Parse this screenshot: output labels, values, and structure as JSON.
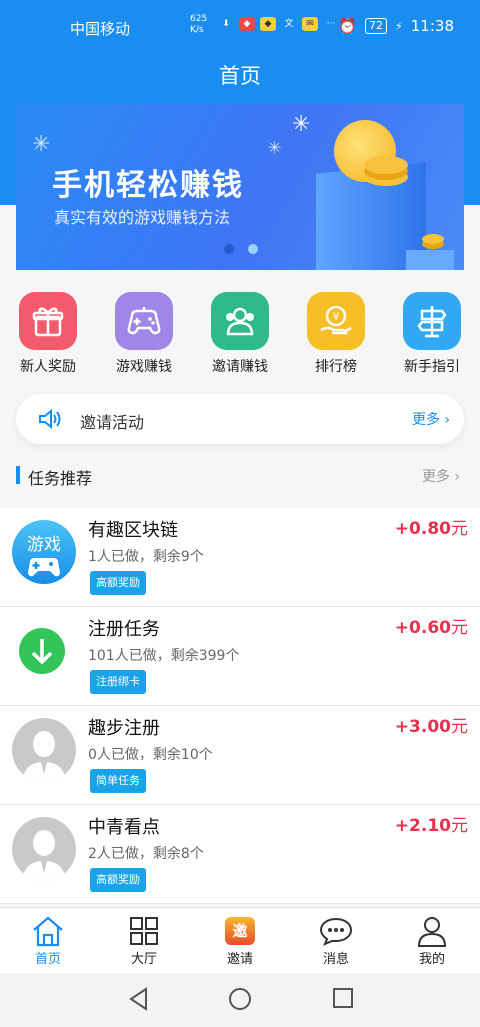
{
  "status": {
    "carrier": "中国移动",
    "net_speed_value": "625",
    "net_speed_unit": "K/s",
    "battery": "72",
    "time": "11:38"
  },
  "header": {
    "title": "首页"
  },
  "banner": {
    "headline": "手机轻松赚钱",
    "subline": "真实有效的游戏赚钱方法",
    "active_dot": 1,
    "dot_count": 2
  },
  "grid": [
    {
      "label": "新人奖励",
      "icon": "gift-icon",
      "color": "#f25b6e"
    },
    {
      "label": "游戏赚钱",
      "icon": "gamepad-icon",
      "color": "#9f86e8"
    },
    {
      "label": "邀请赚钱",
      "icon": "users-icon",
      "color": "#2fba8a"
    },
    {
      "label": "排行榜",
      "icon": "coin-hand-icon",
      "color": "#f8be26"
    },
    {
      "label": "新手指引",
      "icon": "signpost-icon",
      "color": "#30a8f2"
    }
  ],
  "notice": {
    "text": "邀请活动",
    "more": "更多"
  },
  "section": {
    "title": "任务推荐",
    "more": "更多"
  },
  "tasks": [
    {
      "name": "有趣区块链",
      "meta": "1人已做，剩余9个",
      "tag": "高额奖励",
      "price": "+0.80",
      "unit": "元",
      "avatar": "game-avatar",
      "avatar_text": "游戏"
    },
    {
      "name": "注册任务",
      "meta": "101人已做，剩余399个",
      "tag": "注册绑卡",
      "price": "+0.60",
      "unit": "元",
      "avatar": "download-avatar"
    },
    {
      "name": "趣步注册",
      "meta": "0人已做，剩余10个",
      "tag": "简单任务",
      "price": "+3.00",
      "unit": "元",
      "avatar": "person-avatar"
    },
    {
      "name": "中青看点",
      "meta": "2人已做，剩余8个",
      "tag": "高额奖励",
      "price": "+2.10",
      "unit": "元",
      "avatar": "person-avatar"
    }
  ],
  "tabs": [
    {
      "label": "首页",
      "icon": "home-icon",
      "active": true
    },
    {
      "label": "大厅",
      "icon": "grid-icon",
      "active": false
    },
    {
      "label": "邀请",
      "icon": "invite-badge-icon",
      "badge_text": "邀",
      "active": false
    },
    {
      "label": "消息",
      "icon": "message-icon",
      "active": false
    },
    {
      "label": "我的",
      "icon": "profile-icon",
      "active": false
    }
  ],
  "colors": {
    "primary": "#1a8df0",
    "price": "#e8304f",
    "tag": "#1aa3e8"
  }
}
